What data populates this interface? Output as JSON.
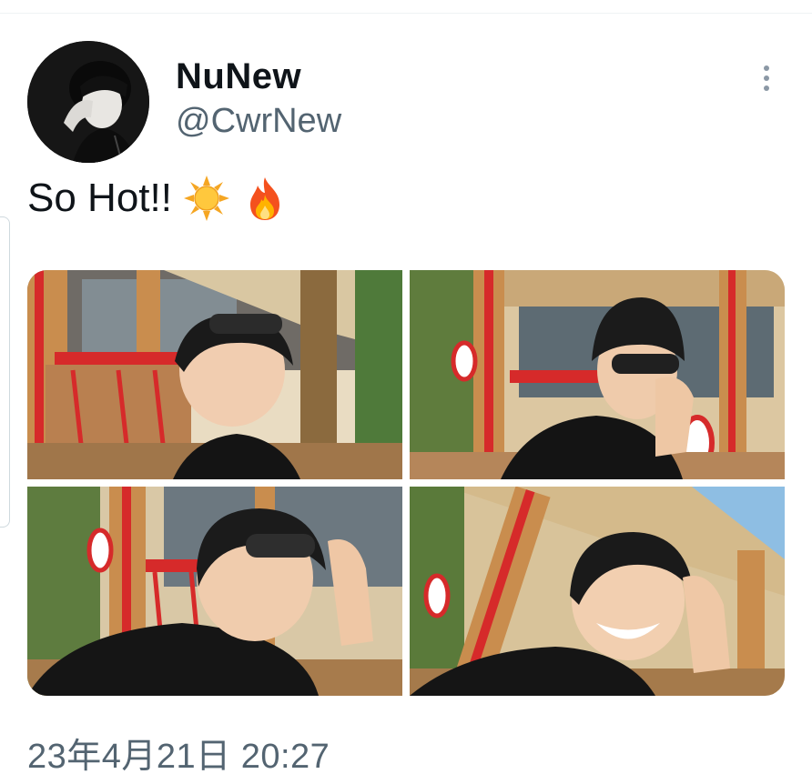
{
  "tweet": {
    "author": {
      "display_name": "NuNew",
      "handle": "@CwrNew",
      "avatar_icon": "profile-photo"
    },
    "text": "So Hot!!",
    "emojis": [
      "sun-emoji",
      "fire-emoji"
    ],
    "menu_icon": "more-vertical-icon",
    "timestamp": "23年4月21日 20:27"
  },
  "media": {
    "count": 4,
    "photos": [
      {
        "description_icon": "photo-1"
      },
      {
        "description_icon": "photo-2"
      },
      {
        "description_icon": "photo-3"
      },
      {
        "description_icon": "photo-4"
      }
    ]
  },
  "colors": {
    "text_primary": "#0f1419",
    "text_secondary": "#536471",
    "divider": "#eff3f4",
    "accent_red": "#d62a2a",
    "wood": "#c98d4e"
  }
}
